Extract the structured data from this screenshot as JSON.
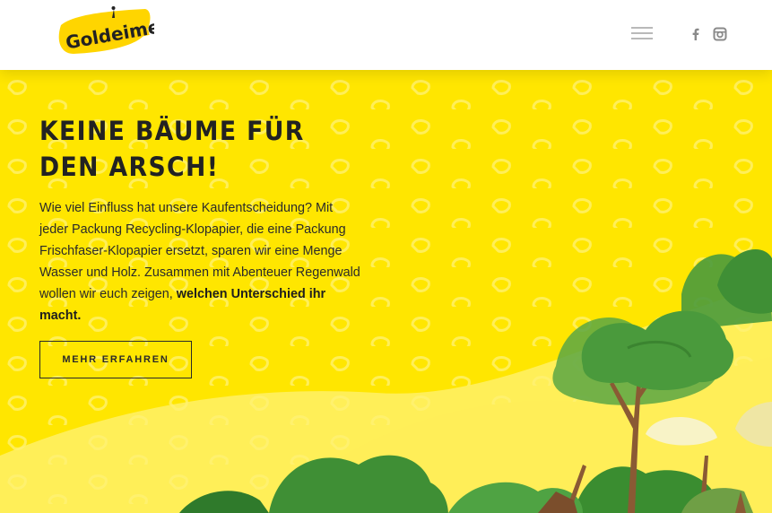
{
  "header": {
    "logo_text": "Goldeimer",
    "menu_icon": "hamburger-menu-icon",
    "social": [
      {
        "name": "facebook-icon"
      },
      {
        "name": "instagram-icon"
      }
    ]
  },
  "hero": {
    "headline": "Keine Bäume für den Arsch!",
    "body": "Wie viel Einfluss hat unsere Kaufentscheidung? Mit jeder Packung Recycling-Klopapier, die eine Packung Frischfaser-Klopapier ersetzt, sparen wir eine Menge Wasser und Holz. Zusammen mit Abenteuer Regenwald wollen wir euch zeigen,",
    "body_bold": "welchen Unterschied ihr macht.",
    "cta_label": "MEHR ERFAHREN"
  },
  "colors": {
    "background": "#ffe600",
    "text": "#2a2a2a",
    "tree_green": "#4a9a3c",
    "trunk_brown": "#8a5a34"
  }
}
